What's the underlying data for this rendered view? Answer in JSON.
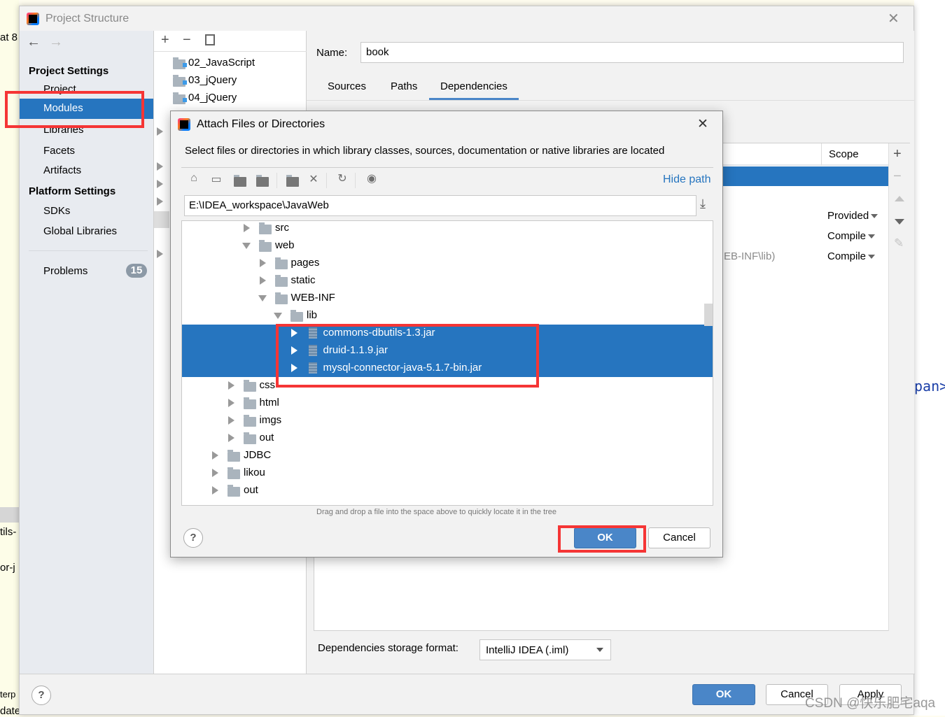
{
  "window": {
    "title": "Project Structure"
  },
  "sidebar": {
    "project_settings": "Project Settings",
    "items": [
      {
        "label": "Project"
      },
      {
        "label": "Modules"
      },
      {
        "label": "Libraries"
      },
      {
        "label": "Facets"
      },
      {
        "label": "Artifacts"
      }
    ],
    "platform_settings": "Platform Settings",
    "platform_items": [
      {
        "label": "SDKs"
      },
      {
        "label": "Global Libraries"
      }
    ],
    "problems": {
      "label": "Problems",
      "count": "15"
    }
  },
  "modules": [
    {
      "label": "02_JavaScript"
    },
    {
      "label": "03_jQuery"
    },
    {
      "label": "04_jQuery"
    }
  ],
  "module_detail": {
    "name_label": "Name:",
    "name_value": "book",
    "tabs": [
      {
        "label": "Sources"
      },
      {
        "label": "Paths"
      },
      {
        "label": "Dependencies"
      }
    ],
    "scope_header": "Scope",
    "scopes": [
      "Provided",
      "Compile",
      "Compile"
    ],
    "partial_path": "EB-INF\\lib)",
    "storage_label": "Dependencies storage format:",
    "storage_value": "IntelliJ IDEA (.iml)"
  },
  "footer": {
    "ok": "OK",
    "cancel": "Cancel",
    "apply": "Apply"
  },
  "dialog": {
    "title": "Attach Files or Directories",
    "description": "Select files or directories in which library classes, sources, documentation or native libraries are located",
    "hide_path": "Hide path",
    "path": "E:\\IDEA_workspace\\JavaWeb",
    "tree": [
      {
        "label": "src",
        "level": 4,
        "state": "collapsed",
        "type": "folder"
      },
      {
        "label": "web",
        "level": 4,
        "state": "expanded",
        "type": "folder"
      },
      {
        "label": "pages",
        "level": 5,
        "state": "collapsed",
        "type": "folder"
      },
      {
        "label": "static",
        "level": 5,
        "state": "collapsed",
        "type": "folder"
      },
      {
        "label": "WEB-INF",
        "level": 5,
        "state": "expanded",
        "type": "folder"
      },
      {
        "label": "lib",
        "level": 6,
        "state": "expanded",
        "type": "folder"
      },
      {
        "label": "commons-dbutils-1.3.jar",
        "level": 7,
        "state": "collapsed",
        "type": "jar",
        "selected": true
      },
      {
        "label": "druid-1.1.9.jar",
        "level": 7,
        "state": "collapsed",
        "type": "jar",
        "selected": true
      },
      {
        "label": "mysql-connector-java-5.1.7-bin.jar",
        "level": 7,
        "state": "collapsed",
        "type": "jar",
        "selected": true
      },
      {
        "label": "css",
        "level": 3,
        "state": "collapsed",
        "type": "folder"
      },
      {
        "label": "html",
        "level": 3,
        "state": "collapsed",
        "type": "folder"
      },
      {
        "label": "imgs",
        "level": 3,
        "state": "collapsed",
        "type": "folder"
      },
      {
        "label": "out",
        "level": 3,
        "state": "collapsed",
        "type": "folder"
      },
      {
        "label": "JDBC",
        "level": 2,
        "state": "collapsed",
        "type": "folder"
      },
      {
        "label": "likou",
        "level": 2,
        "state": "collapsed",
        "type": "folder"
      },
      {
        "label": "out",
        "level": 2,
        "state": "collapsed",
        "type": "folder"
      }
    ],
    "hint": "Drag and drop a file into the space above to quickly locate it in the tree",
    "ok": "OK",
    "cancel": "Cancel"
  },
  "background_fragments": [
    "at 8",
    "tils-",
    "or-j",
    "terp",
    "date",
    "pan>"
  ],
  "watermark": "CSDN @快乐肥宅aqa",
  "colors": {
    "selection": "#2675bf",
    "highlight_box": "#f53535",
    "primary_button": "#4a86c8"
  }
}
